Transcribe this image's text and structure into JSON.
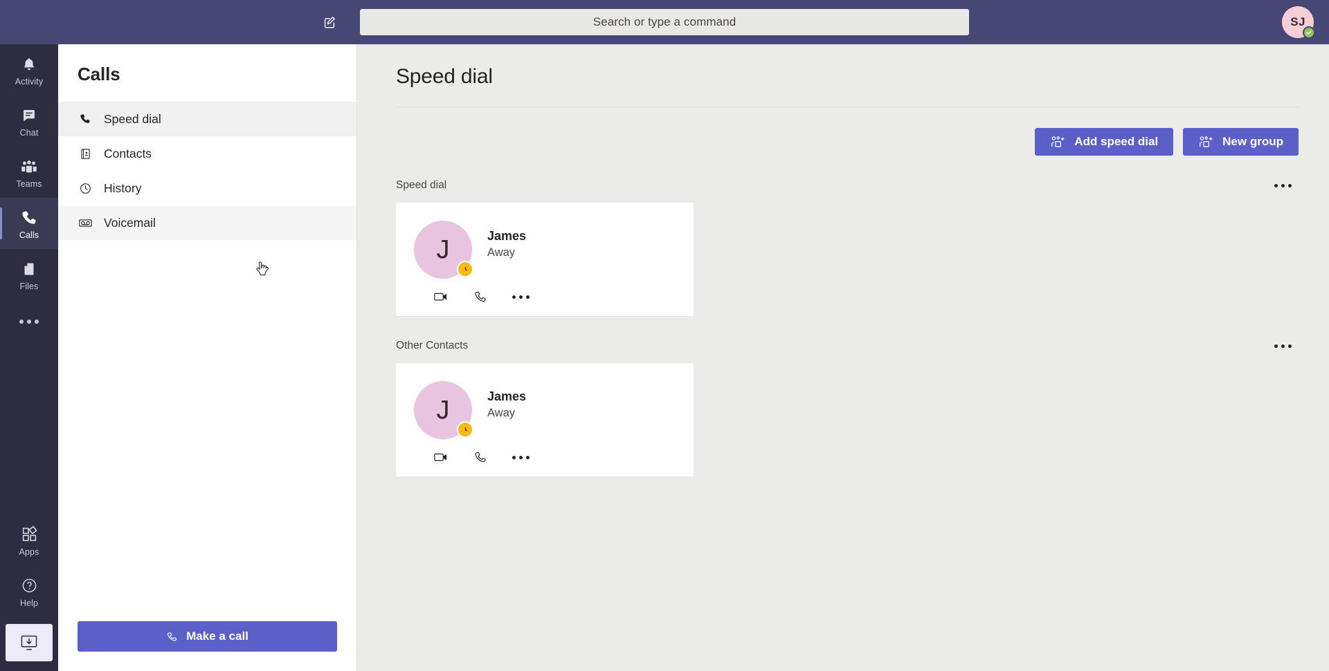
{
  "topbar": {
    "compose_icon": "compose-icon",
    "search": {
      "placeholder": "Search or type a command",
      "value": ""
    },
    "avatar": {
      "initials": "SJ",
      "presence": "Available",
      "presence_color": "#92c353"
    },
    "accent_color": "#464775"
  },
  "rail": {
    "items": [
      {
        "label": "Activity",
        "icon": "bell-icon",
        "active": false
      },
      {
        "label": "Chat",
        "icon": "chat-icon",
        "active": false
      },
      {
        "label": "Teams",
        "icon": "teams-icon",
        "active": false
      },
      {
        "label": "Calls",
        "icon": "phone-icon",
        "active": true
      },
      {
        "label": "Files",
        "icon": "file-icon",
        "active": false
      }
    ],
    "more_icon": "more-horizontal-icon",
    "bottom_items": [
      {
        "label": "Apps",
        "icon": "apps-icon"
      },
      {
        "label": "Help",
        "icon": "help-circle-icon"
      }
    ],
    "download_icon": "download-desktop-app-icon",
    "background_color": "#2d2c40",
    "active_background_color": "#3b3a55"
  },
  "left_panel": {
    "title": "Calls",
    "nav_items": [
      {
        "label": "Speed dial",
        "icon": "phone-icon",
        "state": "selected"
      },
      {
        "label": "Contacts",
        "icon": "contact-card-icon",
        "state": "default"
      },
      {
        "label": "History",
        "icon": "clock-icon",
        "state": "default"
      },
      {
        "label": "Voicemail",
        "icon": "voicemail-icon",
        "state": "hovered"
      }
    ],
    "make_call_button": {
      "label": "Make a call",
      "icon": "phone-icon",
      "color": "#5b5fc7"
    }
  },
  "main": {
    "title": "Speed dial",
    "buttons": [
      {
        "label": "Add speed dial",
        "icon": "add-person-icon"
      },
      {
        "label": "New group",
        "icon": "add-person-icon"
      }
    ],
    "groups": [
      {
        "title": "Speed dial",
        "overflow_icon": "more-horizontal-icon",
        "contacts": [
          {
            "name": "James",
            "status": "Away",
            "initials": "J",
            "avatar_color": "#e9c4e0",
            "presence_color": "#f8b915",
            "presence_icon": "clock-icon",
            "actions": [
              {
                "icon": "video-call-icon",
                "name": "video-call"
              },
              {
                "icon": "audio-call-icon",
                "name": "audio-call"
              },
              {
                "icon": "more-horizontal-icon",
                "name": "more-options"
              }
            ]
          }
        ]
      },
      {
        "title": "Other Contacts",
        "overflow_icon": "more-horizontal-icon",
        "contacts": [
          {
            "name": "James",
            "status": "Away",
            "initials": "J",
            "avatar_color": "#e9c4e0",
            "presence_color": "#f8b915",
            "presence_icon": "clock-icon",
            "actions": [
              {
                "icon": "video-call-icon",
                "name": "video-call"
              },
              {
                "icon": "audio-call-icon",
                "name": "audio-call"
              },
              {
                "icon": "more-horizontal-icon",
                "name": "more-options"
              }
            ]
          }
        ]
      }
    ],
    "background_color": "#ebebe9"
  }
}
